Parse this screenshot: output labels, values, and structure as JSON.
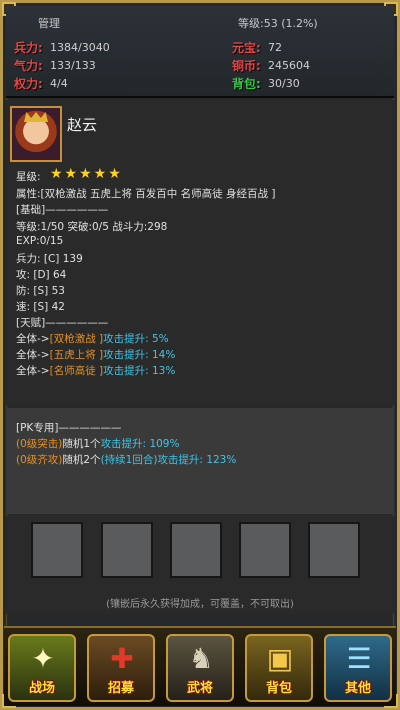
{
  "header": {
    "manage_label": "管理",
    "level_text": "等级:53 (1.2%)",
    "left_stats": [
      {
        "label": "兵力:",
        "value": "1384/3040",
        "color": "#e64545"
      },
      {
        "label": "气力:",
        "value": "133/133",
        "color": "#e64545"
      },
      {
        "label": "权力:",
        "value": "4/4",
        "color": "#e64545"
      }
    ],
    "right_stats": [
      {
        "label": "元宝:",
        "value": "72",
        "color": "#e64545"
      },
      {
        "label": "铜币:",
        "value": "245604",
        "color": "#e64545"
      },
      {
        "label": "背包:",
        "value": "30/30",
        "color": "#3bc648"
      }
    ]
  },
  "hero": {
    "name": "赵云",
    "star_label": "星级:",
    "stars": "★★★★★",
    "star_count": 5,
    "attributes": "属性:[双枪激战 五虎上将 百发百中 名师高徒 身经百战 ]",
    "basic_header": "[基础]——————",
    "level_line": "等级:1/50  突破:0/5 战斗力:298",
    "exp_line": "EXP:0/15",
    "troops_line": "兵力:    [C]  139",
    "attack_line": "攻:    [D]  64",
    "defense_line": "防:    [S]  53",
    "speed_line": "速:    [S]  42",
    "talent_header": "[天赋]——————",
    "talents": [
      {
        "prefix": "全体->",
        "name": "[双枪激战 ]",
        "effect": "攻击提升: 5%"
      },
      {
        "prefix": "全体->",
        "name": "[五虎上将 ]",
        "effect": "攻击提升: 14%"
      },
      {
        "prefix": "全体->",
        "name": "[名师高徒 ]",
        "effect": "攻击提升: 13%"
      }
    ]
  },
  "pk": {
    "header": "[PK专用]——————",
    "lines": [
      {
        "tag": "(0级突击)",
        "mid": "随机1个",
        "extra": "",
        "effect": "攻击提升: 109%"
      },
      {
        "tag": "(0级齐攻)",
        "mid": "随机2个",
        "extra": "(持续1回合)",
        "effect": "攻击提升: 123%"
      }
    ]
  },
  "slots": {
    "count": 5,
    "note": "(镶嵌后永久获得加成，可覆盖，不可取出)"
  },
  "nav": [
    {
      "label": "战场",
      "icon": "sword-burst-icon",
      "glyph": "✦"
    },
    {
      "label": "招募",
      "icon": "recruit-figure-icon",
      "glyph": "✚"
    },
    {
      "label": "武将",
      "icon": "generals-icon",
      "glyph": "♞"
    },
    {
      "label": "背包",
      "icon": "treasure-chest-icon",
      "glyph": "▣"
    },
    {
      "label": "其他",
      "icon": "scroll-stack-icon",
      "glyph": "☰"
    }
  ]
}
